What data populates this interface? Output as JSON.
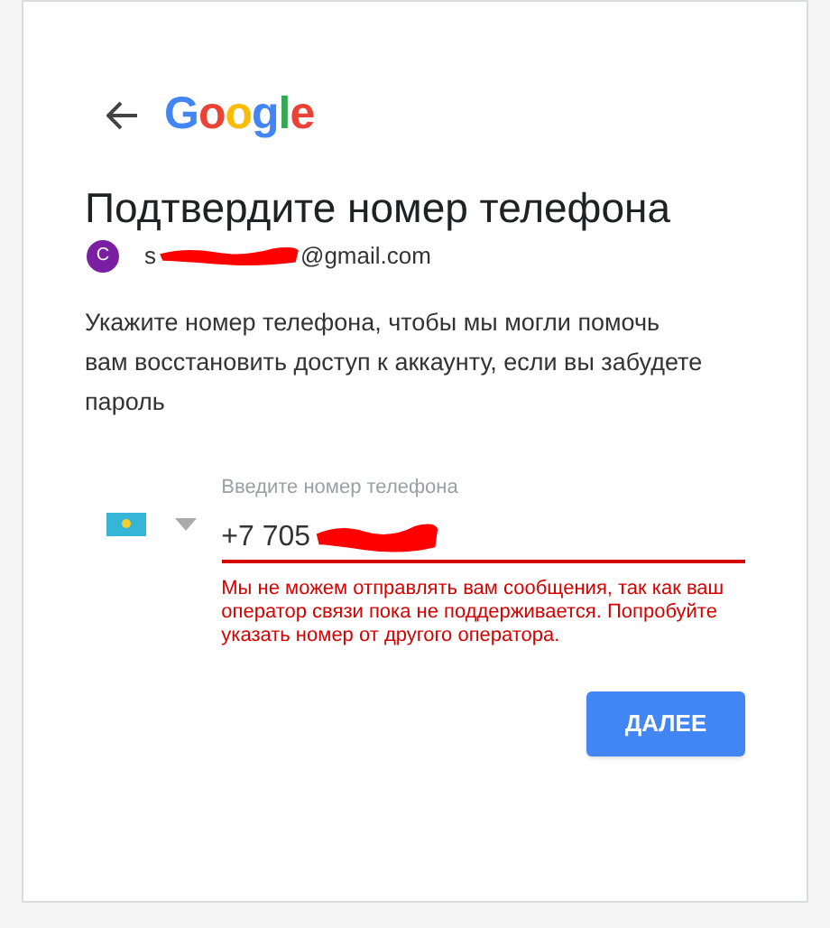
{
  "logo": "Google",
  "title": "Подтвердите номер телефона",
  "account": {
    "avatar_letter": "C",
    "email_start": "s",
    "email_end": "@gmail.com",
    "redacted": true
  },
  "description": "Укажите номер телефона, чтобы мы могли помочь вам восстановить доступ к аккаунту, если вы забудете пароль",
  "phone_field": {
    "label": "Введите номер телефона",
    "value": "+7 705",
    "redacted": true,
    "error": "Мы не можем отправлять вам сообщения, так как ваш оператор связи пока не поддерживается. Попробуйте указать номер от другого оператора."
  },
  "next_button": "ДАЛЕЕ"
}
